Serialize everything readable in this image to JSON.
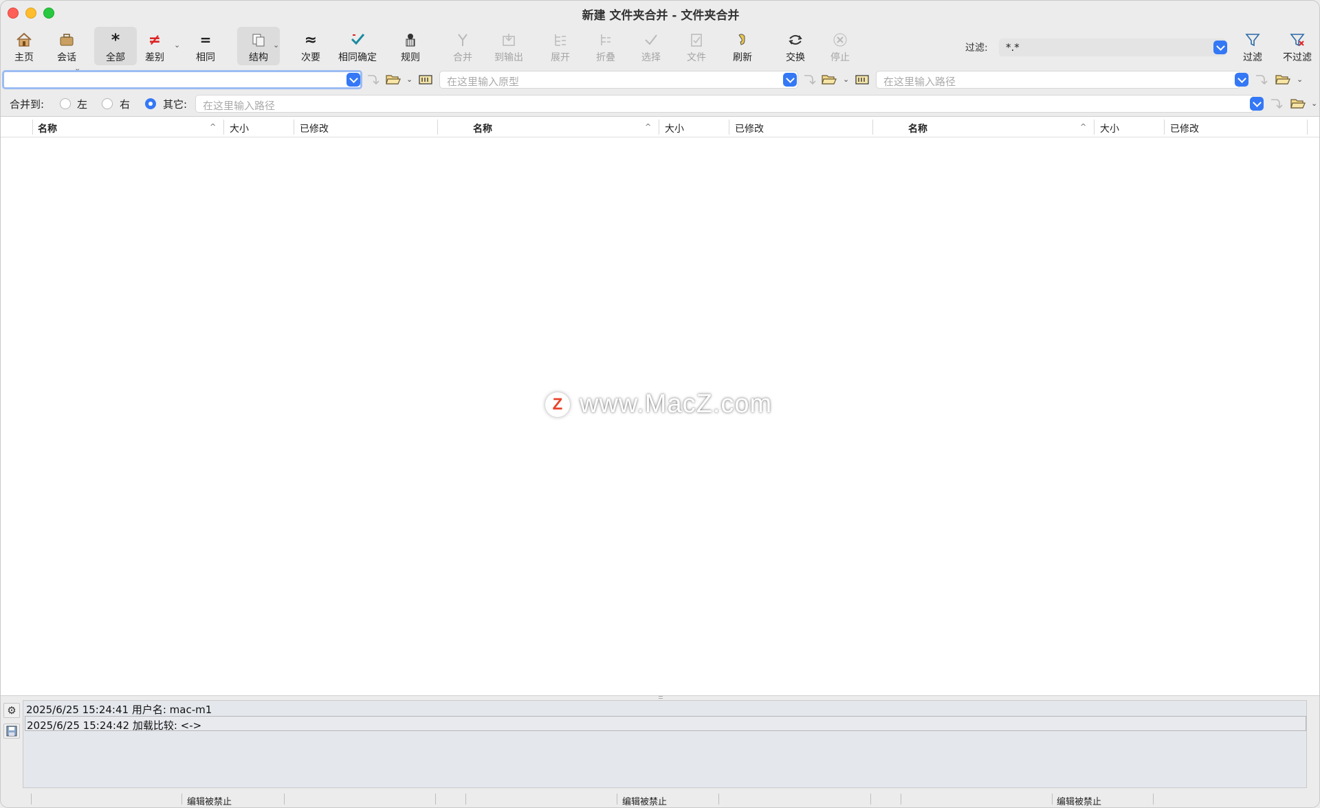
{
  "window": {
    "title": "新建 文件夹合并 - 文件夹合并"
  },
  "toolbar": {
    "home": "主页",
    "session": "会话",
    "all": "全部",
    "diff": "差别",
    "same": "相同",
    "structure": "结构",
    "minor": "次要",
    "same_confirm": "相同确定",
    "rules": "规则",
    "merge": "合并",
    "to_output": "到输出",
    "expand": "展开",
    "collapse": "折叠",
    "select": "选择",
    "files": "文件",
    "refresh": "刷新",
    "swap": "交换",
    "stop": "停止",
    "filter_label": "过滤:",
    "filter_value": "*.*",
    "filter": "过滤",
    "no_filter": "不过滤"
  },
  "paths": {
    "left_value": "",
    "center_placeholder": "在这里输入原型",
    "right_placeholder": "在这里输入路径"
  },
  "merge_to": {
    "label": "合并到:",
    "left": "左",
    "right": "右",
    "other": "其它:",
    "path_placeholder": "在这里输入路径"
  },
  "columns": {
    "name": "名称",
    "size": "大小",
    "modified": "已修改"
  },
  "watermark": {
    "logo": "Z",
    "text": "www.MacZ.com"
  },
  "log": [
    "2025/6/25 15:24:41  用户名:  mac-m1",
    "2025/6/25 15:24:42  加载比较:  <->"
  ],
  "status": {
    "edit_disabled": "编辑被禁止"
  }
}
